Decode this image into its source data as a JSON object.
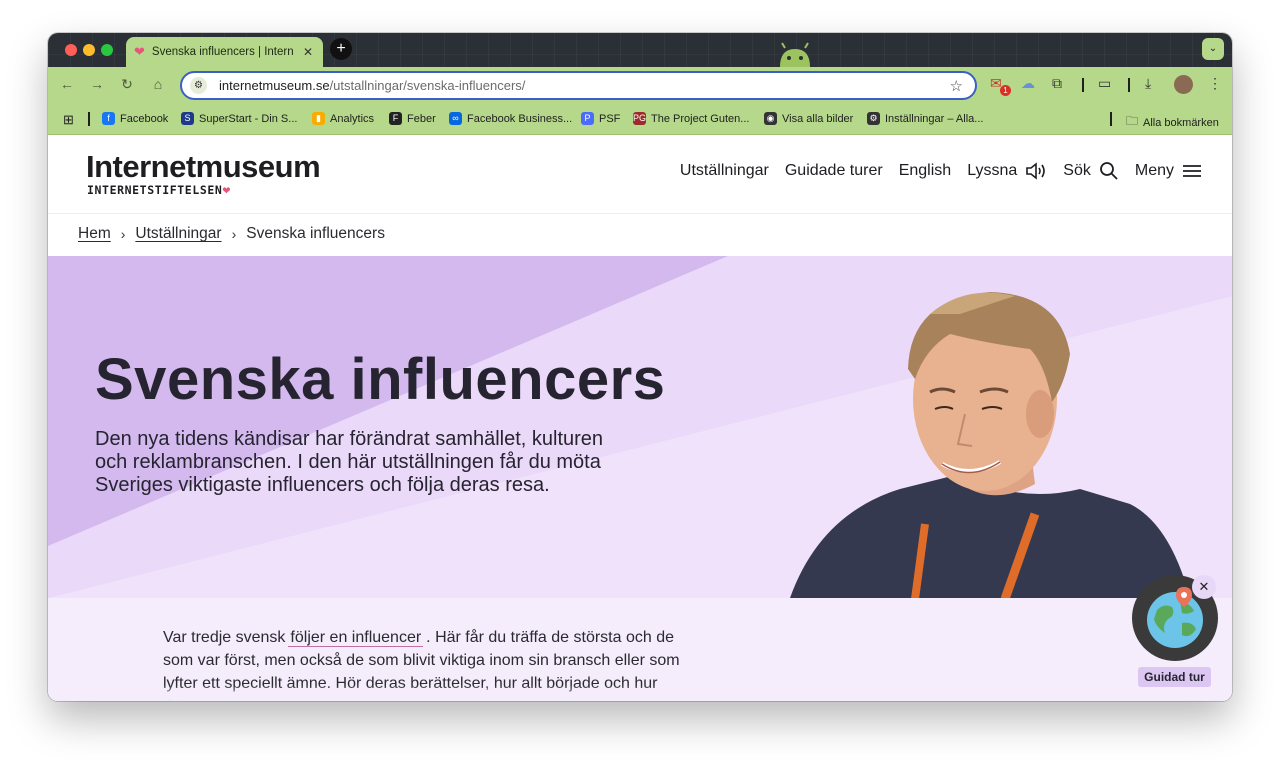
{
  "browser": {
    "tab_title": "Svenska influencers | Internetmuseum",
    "tab_close": "✕",
    "new_tab": "+",
    "url_domain": "internetmuseum.se",
    "url_path": "/utstallningar/svenska-influencers/",
    "extension_badge": "1"
  },
  "bookmarks": [
    {
      "label": "Facebook",
      "icon": "facebook-icon",
      "color": "#1877f2"
    },
    {
      "label": "SuperStart - Din S...",
      "icon": "superstart-icon",
      "color": "#1f3a8a"
    },
    {
      "label": "Analytics",
      "icon": "analytics-icon",
      "color": "#f9ab00"
    },
    {
      "label": "Feber",
      "icon": "feber-icon",
      "color": "#222222"
    },
    {
      "label": "Facebook Business...",
      "icon": "meta-icon",
      "color": "#0668e1"
    },
    {
      "label": "PSF",
      "icon": "psf-icon",
      "color": "#4b6bfb"
    },
    {
      "label": "The Project Guten...",
      "icon": "gutenberg-icon",
      "color": "#9b2c2c"
    },
    {
      "label": "Visa alla bilder",
      "icon": "globe-icon",
      "color": "#333333"
    },
    {
      "label": "Inställningar – Alla...",
      "icon": "gear-icon",
      "color": "#333333"
    }
  ],
  "all_bookmarks": "Alla bokmärken",
  "site": {
    "logo_main": "Internetmuseum",
    "logo_sub": "INTERNETSTIFTELSEN",
    "nav": {
      "exhibitions": "Utställningar",
      "tours": "Guidade turer",
      "english": "English",
      "listen": "Lyssna",
      "search": "Sök",
      "menu": "Meny"
    },
    "breadcrumb": {
      "home": "Hem",
      "exhibitions": "Utställningar",
      "current": "Svenska influencers"
    },
    "hero": {
      "title": "Svenska influencers",
      "lead": "Den nya tidens kändisar har förändrat samhället, kulturen och reklambranschen. I den här utställningen får du möta Sveriges viktigaste influencers och följa deras resa."
    },
    "body": {
      "text_before": "Var tredje svensk",
      "link": "följer en influencer",
      "text_after": ". Här får du träffa de största och de som var först, men också de som blivit viktiga inom sin bransch eller som lyfter ett speciellt ämne. Hör deras berättelser, hur allt började och hur det"
    },
    "guided_tour": {
      "label": "Guidad tur",
      "close": "✕"
    }
  },
  "colors": {
    "hero_bg": "#dcc7f2",
    "body_bg": "#f5ecfc",
    "browser_theme": "#b6d88a",
    "accent_heart": "#e8557a"
  }
}
